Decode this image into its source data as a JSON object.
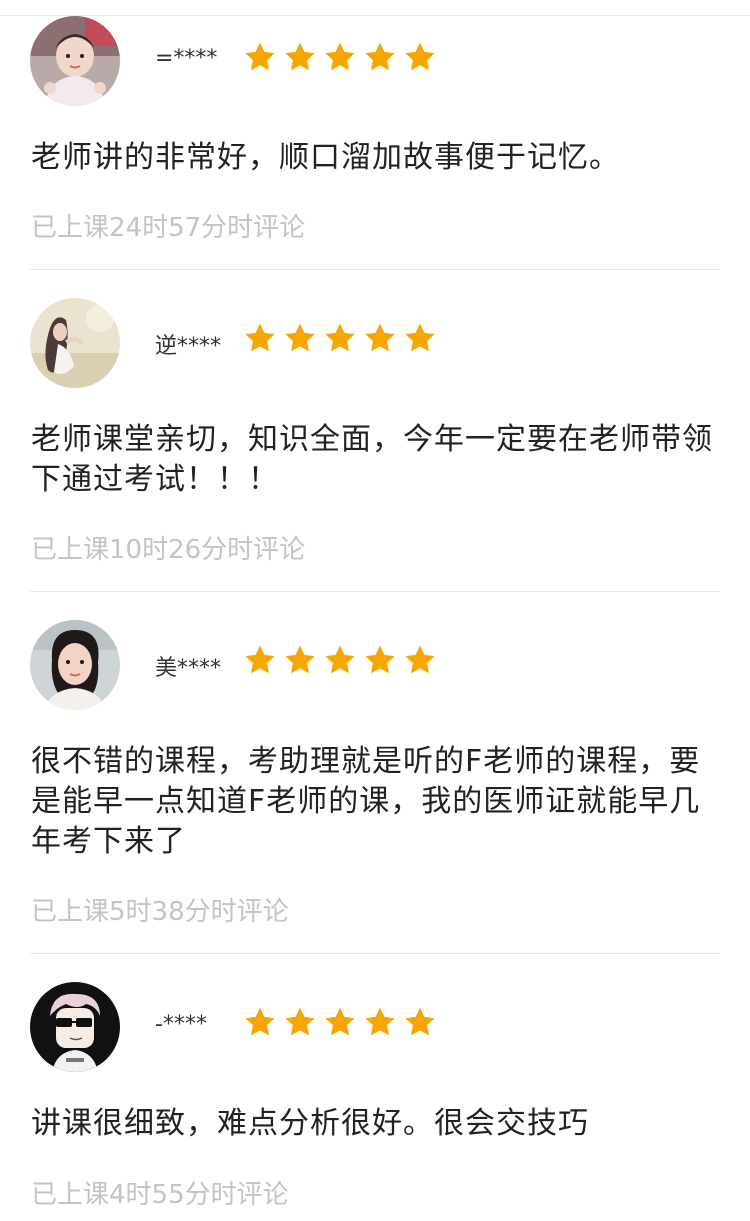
{
  "reviews": [
    {
      "username": "=****",
      "avatar": "baby-photo",
      "rating": 5,
      "comment": "老师讲的非常好，顺口溜加故事便于记忆。",
      "time": "已上课24时57分时评论"
    },
    {
      "username": "逆****",
      "avatar": "woman-scenery-photo",
      "rating": 5,
      "comment": "老师课堂亲切，知识全面，今年一定要在老师带领下通过考试！！！",
      "time": "已上课10时26分时评论"
    },
    {
      "username": "美****",
      "avatar": "woman-portrait-photo",
      "rating": 5,
      "comment": "很不错的课程，考助理就是听的F老师的课程，要是能早一点知道F老师的课，我的医师证就能早几年考下来了",
      "time": "已上课5时38分时评论"
    },
    {
      "username": "-****",
      "avatar": "cartoon-sunglasses-character",
      "rating": 5,
      "comment": "讲课很细致，难点分析很好。很会交技巧",
      "time": "已上课4时55分时评论"
    }
  ],
  "colors": {
    "star": "#f7a600",
    "time_text": "#c4c4c4",
    "comment_text": "#222222",
    "divider": "#e8e8e8"
  }
}
